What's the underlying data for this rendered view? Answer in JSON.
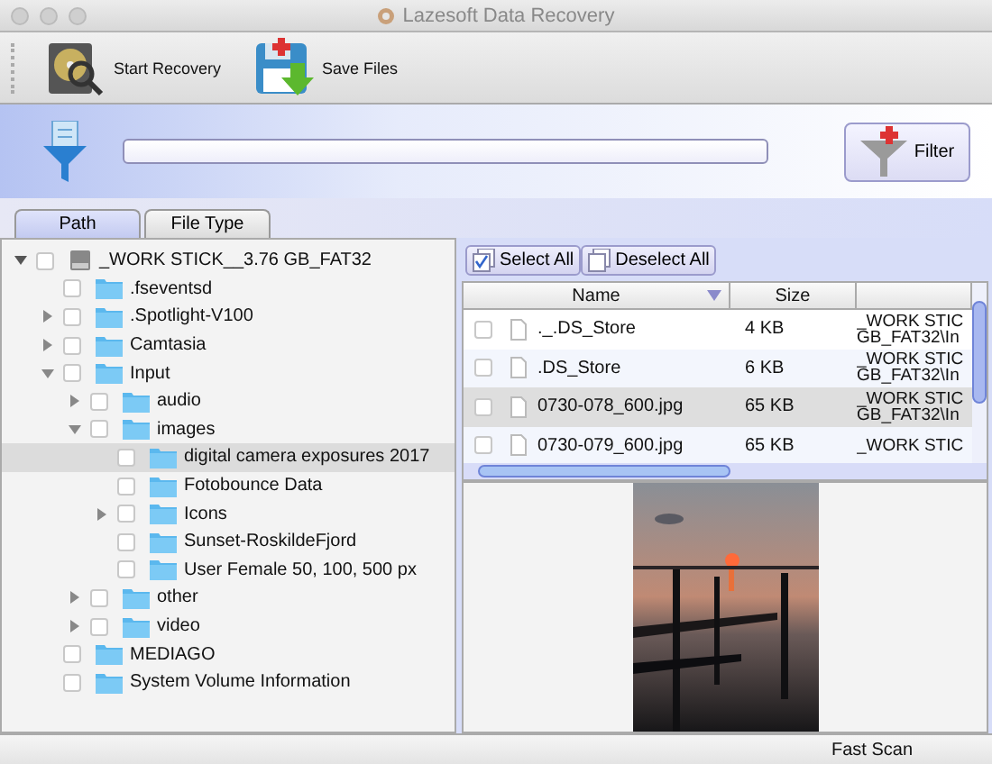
{
  "window": {
    "title": "Lazesoft Data Recovery"
  },
  "toolbar": [
    {
      "kind": "recover",
      "label": "Start Recovery"
    },
    {
      "kind": "save",
      "label": "Save Files"
    }
  ],
  "filter": {
    "button": "Filter"
  },
  "tabs": [
    {
      "label": "Path",
      "selected": true
    },
    {
      "label": "File Type",
      "selected": false
    }
  ],
  "tree": [
    {
      "name": "_WORK STICK__3.76 GB_FAT32",
      "kind": "drive",
      "checked": false,
      "selected": false,
      "expanded": true,
      "children": [
        {
          "name": ".fseventsd",
          "kind": "folder",
          "checked": false,
          "selected": false
        },
        {
          "name": ".Spotlight-V100",
          "kind": "folder",
          "checked": false,
          "selected": false,
          "expanded": false
        },
        {
          "name": "Camtasia",
          "kind": "folder",
          "checked": false,
          "selected": false,
          "expanded": false
        },
        {
          "name": "Input",
          "kind": "folder",
          "checked": false,
          "selected": false,
          "expanded": true,
          "children": [
            {
              "name": "audio",
              "kind": "folder",
              "checked": false,
              "selected": false,
              "expanded": false
            },
            {
              "name": "images",
              "kind": "folder",
              "checked": false,
              "selected": false,
              "expanded": true,
              "children": [
                {
                  "name": "digital camera exposures 2017",
                  "kind": "folder",
                  "checked": false,
                  "selected": true
                },
                {
                  "name": "Fotobounce Data",
                  "kind": "folder",
                  "checked": false,
                  "selected": false
                },
                {
                  "name": "Icons",
                  "kind": "folder",
                  "checked": false,
                  "selected": false,
                  "expanded": false
                },
                {
                  "name": "Sunset-RoskildeFjord",
                  "kind": "folder",
                  "checked": false,
                  "selected": false
                },
                {
                  "name": "User Female 50, 100, 500 px",
                  "kind": "folder",
                  "checked": false,
                  "selected": false
                }
              ]
            },
            {
              "name": "other",
              "kind": "folder",
              "checked": false,
              "selected": false,
              "expanded": false
            },
            {
              "name": "video",
              "kind": "folder",
              "checked": false,
              "selected": false,
              "expanded": false
            }
          ]
        },
        {
          "name": "MEDIAGO",
          "kind": "folder",
          "checked": false,
          "selected": false
        },
        {
          "name": "System Volume Information",
          "kind": "folder",
          "checked": false,
          "selected": false
        }
      ]
    }
  ],
  "file_actions": [
    {
      "kind": "select",
      "label": "Select All"
    },
    {
      "kind": "deselect",
      "label": "Deselect All"
    }
  ],
  "files": {
    "columns": [
      "Name",
      "Size"
    ],
    "rows": [
      {
        "name": "._.DS_Store",
        "size": "4 KB",
        "column_3": [
          "_WORK STIC",
          "GB_FAT32\\In"
        ],
        "checked": false,
        "selected": false
      },
      {
        "name": ".DS_Store",
        "size": "6 KB",
        "column_3": [
          "_WORK STIC",
          "GB_FAT32\\In"
        ],
        "checked": false,
        "selected": false
      },
      {
        "name": "0730-078_600.jpg",
        "size": "65 KB",
        "column_3": [
          "_WORK STIC",
          "GB_FAT32\\In"
        ],
        "checked": false,
        "selected": true
      },
      {
        "name": "0730-079_600.jpg",
        "size": "65 KB",
        "column_3": [
          "_WORK STIC"
        ],
        "checked": false,
        "selected": false
      }
    ]
  },
  "status_bar": {
    "text": "Fast Scan"
  }
}
